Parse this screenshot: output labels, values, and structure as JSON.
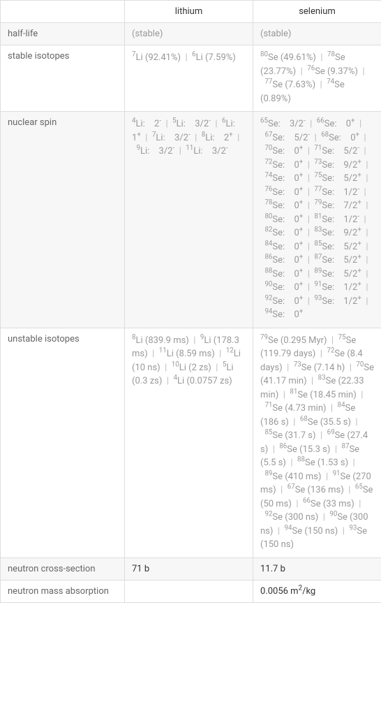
{
  "headers": {
    "c1": "lithium",
    "c2": "selenium"
  },
  "rows": {
    "half_life": {
      "label": "half-life",
      "c1": "(stable)",
      "c2": "(stable)"
    },
    "stable": {
      "label": "stable isotopes",
      "c1": [
        {
          "mass": "7",
          "el": "Li",
          "abund": "(92.41%)"
        },
        {
          "mass": "6",
          "el": "Li",
          "abund": "(7.59%)"
        }
      ],
      "c2": [
        {
          "mass": "80",
          "el": "Se",
          "abund": "(49.61%)"
        },
        {
          "mass": "78",
          "el": "Se",
          "abund": "(23.77%)"
        },
        {
          "mass": "76",
          "el": "Se",
          "abund": "(9.37%)"
        },
        {
          "mass": "77",
          "el": "Se",
          "abund": "(7.63%)"
        },
        {
          "mass": "74",
          "el": "Se",
          "abund": "(0.89%)"
        }
      ]
    },
    "spin": {
      "label": "nuclear spin",
      "c1": [
        {
          "mass": "4",
          "el": "Li",
          "spin": "2",
          "sign": "-"
        },
        {
          "mass": "5",
          "el": "Li",
          "spin": "3/2",
          "sign": "-"
        },
        {
          "mass": "6",
          "el": "Li",
          "spin": "1",
          "sign": "+"
        },
        {
          "mass": "7",
          "el": "Li",
          "spin": "3/2",
          "sign": "-"
        },
        {
          "mass": "8",
          "el": "Li",
          "spin": "2",
          "sign": "+"
        },
        {
          "mass": "9",
          "el": "Li",
          "spin": "3/2",
          "sign": "-"
        },
        {
          "mass": "11",
          "el": "Li",
          "spin": "3/2",
          "sign": "-"
        }
      ],
      "c2": [
        {
          "mass": "65",
          "el": "Se",
          "spin": "3/2",
          "sign": "-"
        },
        {
          "mass": "66",
          "el": "Se",
          "spin": "0",
          "sign": "+"
        },
        {
          "mass": "67",
          "el": "Se",
          "spin": "5/2",
          "sign": "-"
        },
        {
          "mass": "68",
          "el": "Se",
          "spin": "0",
          "sign": "+"
        },
        {
          "mass": "70",
          "el": "Se",
          "spin": "0",
          "sign": "+"
        },
        {
          "mass": "71",
          "el": "Se",
          "spin": "5/2",
          "sign": "-"
        },
        {
          "mass": "72",
          "el": "Se",
          "spin": "0",
          "sign": "+"
        },
        {
          "mass": "73",
          "el": "Se",
          "spin": "9/2",
          "sign": "+"
        },
        {
          "mass": "74",
          "el": "Se",
          "spin": "0",
          "sign": "+"
        },
        {
          "mass": "75",
          "el": "Se",
          "spin": "5/2",
          "sign": "+"
        },
        {
          "mass": "76",
          "el": "Se",
          "spin": "0",
          "sign": "+"
        },
        {
          "mass": "77",
          "el": "Se",
          "spin": "1/2",
          "sign": "-"
        },
        {
          "mass": "78",
          "el": "Se",
          "spin": "0",
          "sign": "+"
        },
        {
          "mass": "79",
          "el": "Se",
          "spin": "7/2",
          "sign": "+"
        },
        {
          "mass": "80",
          "el": "Se",
          "spin": "0",
          "sign": "+"
        },
        {
          "mass": "81",
          "el": "Se",
          "spin": "1/2",
          "sign": "-"
        },
        {
          "mass": "82",
          "el": "Se",
          "spin": "0",
          "sign": "+"
        },
        {
          "mass": "83",
          "el": "Se",
          "spin": "9/2",
          "sign": "+"
        },
        {
          "mass": "84",
          "el": "Se",
          "spin": "0",
          "sign": "+"
        },
        {
          "mass": "85",
          "el": "Se",
          "spin": "5/2",
          "sign": "+"
        },
        {
          "mass": "86",
          "el": "Se",
          "spin": "0",
          "sign": "+"
        },
        {
          "mass": "87",
          "el": "Se",
          "spin": "5/2",
          "sign": "+"
        },
        {
          "mass": "88",
          "el": "Se",
          "spin": "0",
          "sign": "+"
        },
        {
          "mass": "89",
          "el": "Se",
          "spin": "5/2",
          "sign": "+"
        },
        {
          "mass": "90",
          "el": "Se",
          "spin": "0",
          "sign": "+"
        },
        {
          "mass": "91",
          "el": "Se",
          "spin": "1/2",
          "sign": "+"
        },
        {
          "mass": "92",
          "el": "Se",
          "spin": "0",
          "sign": "+"
        },
        {
          "mass": "93",
          "el": "Se",
          "spin": "1/2",
          "sign": "+"
        },
        {
          "mass": "94",
          "el": "Se",
          "spin": "0",
          "sign": "+"
        }
      ]
    },
    "unstable": {
      "label": "unstable isotopes",
      "c1": [
        {
          "mass": "8",
          "el": "Li",
          "hl": "(839.9 ms)"
        },
        {
          "mass": "9",
          "el": "Li",
          "hl": "(178.3 ms)"
        },
        {
          "mass": "11",
          "el": "Li",
          "hl": "(8.59 ms)"
        },
        {
          "mass": "12",
          "el": "Li",
          "hl": "(10 ns)"
        },
        {
          "mass": "10",
          "el": "Li",
          "hl": "(2 zs)"
        },
        {
          "mass": "5",
          "el": "Li",
          "hl": "(0.3 zs)"
        },
        {
          "mass": "4",
          "el": "Li",
          "hl": "(0.0757 zs)"
        }
      ],
      "c2": [
        {
          "mass": "79",
          "el": "Se",
          "hl": "(0.295 Myr)"
        },
        {
          "mass": "75",
          "el": "Se",
          "hl": "(119.79 days)"
        },
        {
          "mass": "72",
          "el": "Se",
          "hl": "(8.4 days)"
        },
        {
          "mass": "73",
          "el": "Se",
          "hl": "(7.14 h)"
        },
        {
          "mass": "70",
          "el": "Se",
          "hl": "(41.17 min)"
        },
        {
          "mass": "83",
          "el": "Se",
          "hl": "(22.33 min)"
        },
        {
          "mass": "81",
          "el": "Se",
          "hl": "(18.45 min)"
        },
        {
          "mass": "71",
          "el": "Se",
          "hl": "(4.73 min)"
        },
        {
          "mass": "84",
          "el": "Se",
          "hl": "(186 s)"
        },
        {
          "mass": "68",
          "el": "Se",
          "hl": "(35.5 s)"
        },
        {
          "mass": "85",
          "el": "Se",
          "hl": "(31.7 s)"
        },
        {
          "mass": "69",
          "el": "Se",
          "hl": "(27.4 s)"
        },
        {
          "mass": "86",
          "el": "Se",
          "hl": "(15.3 s)"
        },
        {
          "mass": "87",
          "el": "Se",
          "hl": "(5.5 s)"
        },
        {
          "mass": "88",
          "el": "Se",
          "hl": "(1.53 s)"
        },
        {
          "mass": "89",
          "el": "Se",
          "hl": "(410 ms)"
        },
        {
          "mass": "91",
          "el": "Se",
          "hl": "(270 ms)"
        },
        {
          "mass": "67",
          "el": "Se",
          "hl": "(136 ms)"
        },
        {
          "mass": "65",
          "el": "Se",
          "hl": "(50 ms)"
        },
        {
          "mass": "66",
          "el": "Se",
          "hl": "(33 ms)"
        },
        {
          "mass": "92",
          "el": "Se",
          "hl": "(300 ns)"
        },
        {
          "mass": "90",
          "el": "Se",
          "hl": "(300 ns)"
        },
        {
          "mass": "94",
          "el": "Se",
          "hl": "(150 ns)"
        },
        {
          "mass": "93",
          "el": "Se",
          "hl": "(150 ns)"
        }
      ]
    },
    "ncs": {
      "label": "neutron cross-section",
      "c1": "71 b",
      "c2": "11.7 b"
    },
    "nma": {
      "label": "neutron mass absorption",
      "c1": "",
      "c2_val": "0.0056 m",
      "c2_exp": "2",
      "c2_unit": "/kg"
    }
  },
  "sep": "|"
}
